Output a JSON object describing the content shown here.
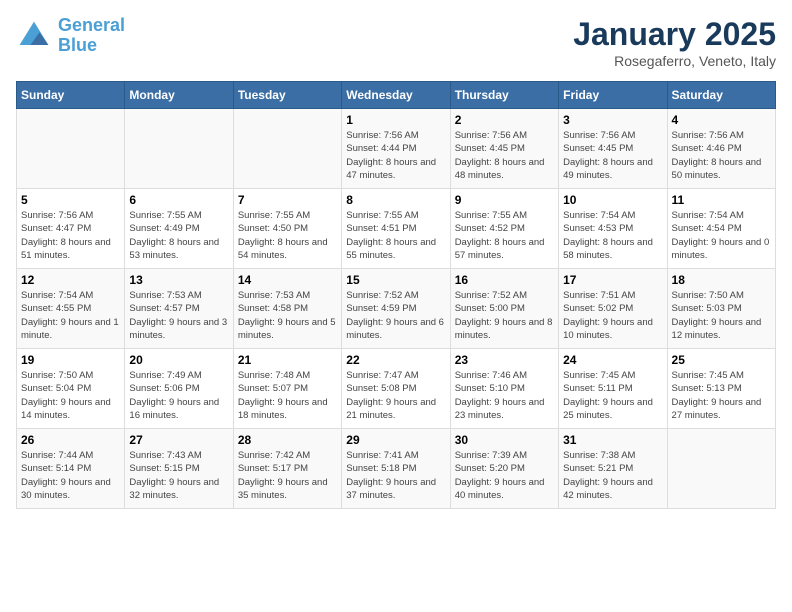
{
  "logo": {
    "line1": "General",
    "line2": "Blue"
  },
  "title": "January 2025",
  "subtitle": "Rosegaferro, Veneto, Italy",
  "weekdays": [
    "Sunday",
    "Monday",
    "Tuesday",
    "Wednesday",
    "Thursday",
    "Friday",
    "Saturday"
  ],
  "weeks": [
    [
      {
        "day": "",
        "info": ""
      },
      {
        "day": "",
        "info": ""
      },
      {
        "day": "",
        "info": ""
      },
      {
        "day": "1",
        "info": "Sunrise: 7:56 AM\nSunset: 4:44 PM\nDaylight: 8 hours and 47 minutes."
      },
      {
        "day": "2",
        "info": "Sunrise: 7:56 AM\nSunset: 4:45 PM\nDaylight: 8 hours and 48 minutes."
      },
      {
        "day": "3",
        "info": "Sunrise: 7:56 AM\nSunset: 4:45 PM\nDaylight: 8 hours and 49 minutes."
      },
      {
        "day": "4",
        "info": "Sunrise: 7:56 AM\nSunset: 4:46 PM\nDaylight: 8 hours and 50 minutes."
      }
    ],
    [
      {
        "day": "5",
        "info": "Sunrise: 7:56 AM\nSunset: 4:47 PM\nDaylight: 8 hours and 51 minutes."
      },
      {
        "day": "6",
        "info": "Sunrise: 7:55 AM\nSunset: 4:49 PM\nDaylight: 8 hours and 53 minutes."
      },
      {
        "day": "7",
        "info": "Sunrise: 7:55 AM\nSunset: 4:50 PM\nDaylight: 8 hours and 54 minutes."
      },
      {
        "day": "8",
        "info": "Sunrise: 7:55 AM\nSunset: 4:51 PM\nDaylight: 8 hours and 55 minutes."
      },
      {
        "day": "9",
        "info": "Sunrise: 7:55 AM\nSunset: 4:52 PM\nDaylight: 8 hours and 57 minutes."
      },
      {
        "day": "10",
        "info": "Sunrise: 7:54 AM\nSunset: 4:53 PM\nDaylight: 8 hours and 58 minutes."
      },
      {
        "day": "11",
        "info": "Sunrise: 7:54 AM\nSunset: 4:54 PM\nDaylight: 9 hours and 0 minutes."
      }
    ],
    [
      {
        "day": "12",
        "info": "Sunrise: 7:54 AM\nSunset: 4:55 PM\nDaylight: 9 hours and 1 minute."
      },
      {
        "day": "13",
        "info": "Sunrise: 7:53 AM\nSunset: 4:57 PM\nDaylight: 9 hours and 3 minutes."
      },
      {
        "day": "14",
        "info": "Sunrise: 7:53 AM\nSunset: 4:58 PM\nDaylight: 9 hours and 5 minutes."
      },
      {
        "day": "15",
        "info": "Sunrise: 7:52 AM\nSunset: 4:59 PM\nDaylight: 9 hours and 6 minutes."
      },
      {
        "day": "16",
        "info": "Sunrise: 7:52 AM\nSunset: 5:00 PM\nDaylight: 9 hours and 8 minutes."
      },
      {
        "day": "17",
        "info": "Sunrise: 7:51 AM\nSunset: 5:02 PM\nDaylight: 9 hours and 10 minutes."
      },
      {
        "day": "18",
        "info": "Sunrise: 7:50 AM\nSunset: 5:03 PM\nDaylight: 9 hours and 12 minutes."
      }
    ],
    [
      {
        "day": "19",
        "info": "Sunrise: 7:50 AM\nSunset: 5:04 PM\nDaylight: 9 hours and 14 minutes."
      },
      {
        "day": "20",
        "info": "Sunrise: 7:49 AM\nSunset: 5:06 PM\nDaylight: 9 hours and 16 minutes."
      },
      {
        "day": "21",
        "info": "Sunrise: 7:48 AM\nSunset: 5:07 PM\nDaylight: 9 hours and 18 minutes."
      },
      {
        "day": "22",
        "info": "Sunrise: 7:47 AM\nSunset: 5:08 PM\nDaylight: 9 hours and 21 minutes."
      },
      {
        "day": "23",
        "info": "Sunrise: 7:46 AM\nSunset: 5:10 PM\nDaylight: 9 hours and 23 minutes."
      },
      {
        "day": "24",
        "info": "Sunrise: 7:45 AM\nSunset: 5:11 PM\nDaylight: 9 hours and 25 minutes."
      },
      {
        "day": "25",
        "info": "Sunrise: 7:45 AM\nSunset: 5:13 PM\nDaylight: 9 hours and 27 minutes."
      }
    ],
    [
      {
        "day": "26",
        "info": "Sunrise: 7:44 AM\nSunset: 5:14 PM\nDaylight: 9 hours and 30 minutes."
      },
      {
        "day": "27",
        "info": "Sunrise: 7:43 AM\nSunset: 5:15 PM\nDaylight: 9 hours and 32 minutes."
      },
      {
        "day": "28",
        "info": "Sunrise: 7:42 AM\nSunset: 5:17 PM\nDaylight: 9 hours and 35 minutes."
      },
      {
        "day": "29",
        "info": "Sunrise: 7:41 AM\nSunset: 5:18 PM\nDaylight: 9 hours and 37 minutes."
      },
      {
        "day": "30",
        "info": "Sunrise: 7:39 AM\nSunset: 5:20 PM\nDaylight: 9 hours and 40 minutes."
      },
      {
        "day": "31",
        "info": "Sunrise: 7:38 AM\nSunset: 5:21 PM\nDaylight: 9 hours and 42 minutes."
      },
      {
        "day": "",
        "info": ""
      }
    ]
  ]
}
